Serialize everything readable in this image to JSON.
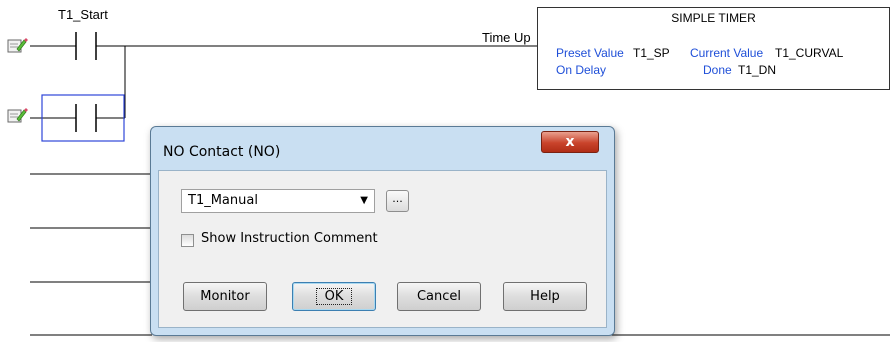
{
  "ladder": {
    "contact_tag_1": "T1_Start",
    "coil_output_label": "Time Up"
  },
  "timer_block": {
    "title": "SIMPLE TIMER",
    "preset_label": "Preset Value",
    "preset_tag": "T1_SP",
    "current_label": "Current Value",
    "current_tag": "T1_CURVAL",
    "mode_label": "On Delay",
    "done_label": "Done",
    "done_tag": "T1_DN"
  },
  "dialog": {
    "title": "NO Contact (NO)",
    "close_symbol": "x",
    "tag_value": "T1_Manual",
    "browse_label": "...",
    "show_comment_label": "Show Instruction Comment",
    "show_comment_checked": false,
    "buttons": {
      "monitor": "Monitor",
      "ok": "OK",
      "cancel": "Cancel",
      "help": "Help"
    }
  },
  "colors": {
    "accent_blue": "#1f4fd8",
    "dialog_frame": "#c9dff2",
    "close_red": "#c9432b"
  }
}
